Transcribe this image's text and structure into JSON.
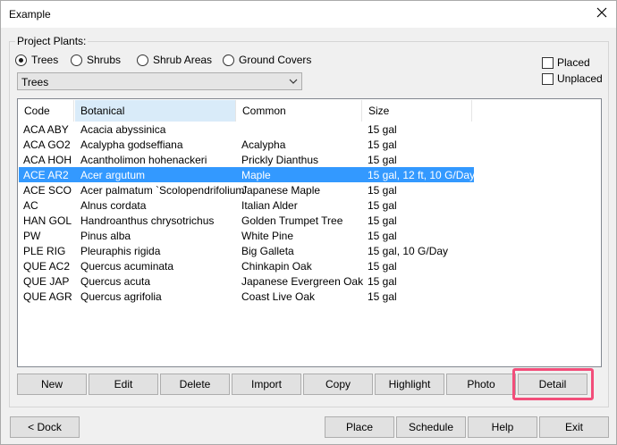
{
  "window": {
    "title": "Example"
  },
  "group": {
    "label": "Project Plants:"
  },
  "radios": [
    {
      "label": "Trees",
      "checked": true
    },
    {
      "label": "Shrubs",
      "checked": false
    },
    {
      "label": "Shrub Areas",
      "checked": false
    },
    {
      "label": "Ground Covers",
      "checked": false
    }
  ],
  "checks": [
    {
      "label": "Placed",
      "checked": false
    },
    {
      "label": "Unplaced",
      "checked": false
    }
  ],
  "dropdown": {
    "value": "Trees"
  },
  "table": {
    "columns": [
      "Code",
      "Botanical",
      "Common",
      "Size"
    ],
    "rows": [
      [
        "ACA ABY",
        "Acacia abyssinica",
        "",
        "15 gal"
      ],
      [
        "ACA GO2",
        "Acalypha godseffiana",
        "Acalypha",
        "15 gal"
      ],
      [
        "ACA HOH",
        "Acantholimon hohenackeri",
        "Prickly Dianthus",
        "15 gal"
      ],
      [
        "ACE AR2",
        "Acer argutum",
        "Maple",
        "15 gal, 12 ft, 10 G/Day"
      ],
      [
        "ACE SCO",
        "Acer palmatum  `Scolopendrifolium`",
        "Japanese Maple",
        "15 gal"
      ],
      [
        "AC",
        "Alnus cordata",
        "Italian Alder",
        "15 gal"
      ],
      [
        "HAN GOL",
        "Handroanthus chrysotrichus",
        "Golden Trumpet Tree",
        "15 gal"
      ],
      [
        "PW",
        "Pinus alba",
        "White Pine",
        "15 gal"
      ],
      [
        "PLE RIG",
        "Pleuraphis rigida",
        "Big Galleta",
        "15 gal, 10 G/Day"
      ],
      [
        "QUE AC2",
        "Quercus acuminata",
        "Chinkapin Oak",
        "15 gal"
      ],
      [
        "QUE JAP",
        "Quercus acuta",
        "Japanese Evergreen Oak",
        "15 gal"
      ],
      [
        "QUE AGR",
        "Quercus agrifolia",
        "Coast Live Oak",
        "15 gal"
      ]
    ],
    "selected_index": 3
  },
  "action_buttons": [
    "New",
    "Edit",
    "Delete",
    "Import",
    "Copy",
    "Highlight",
    "Photo",
    "Detail"
  ],
  "footer_buttons": {
    "dock": "< Dock",
    "place": "Place",
    "schedule": "Schedule",
    "help": "Help",
    "exit": "Exit"
  },
  "colors": {
    "selection": "#3399ff",
    "sorted_header": "#d9ebf9",
    "annotation": "#f24e7a"
  }
}
